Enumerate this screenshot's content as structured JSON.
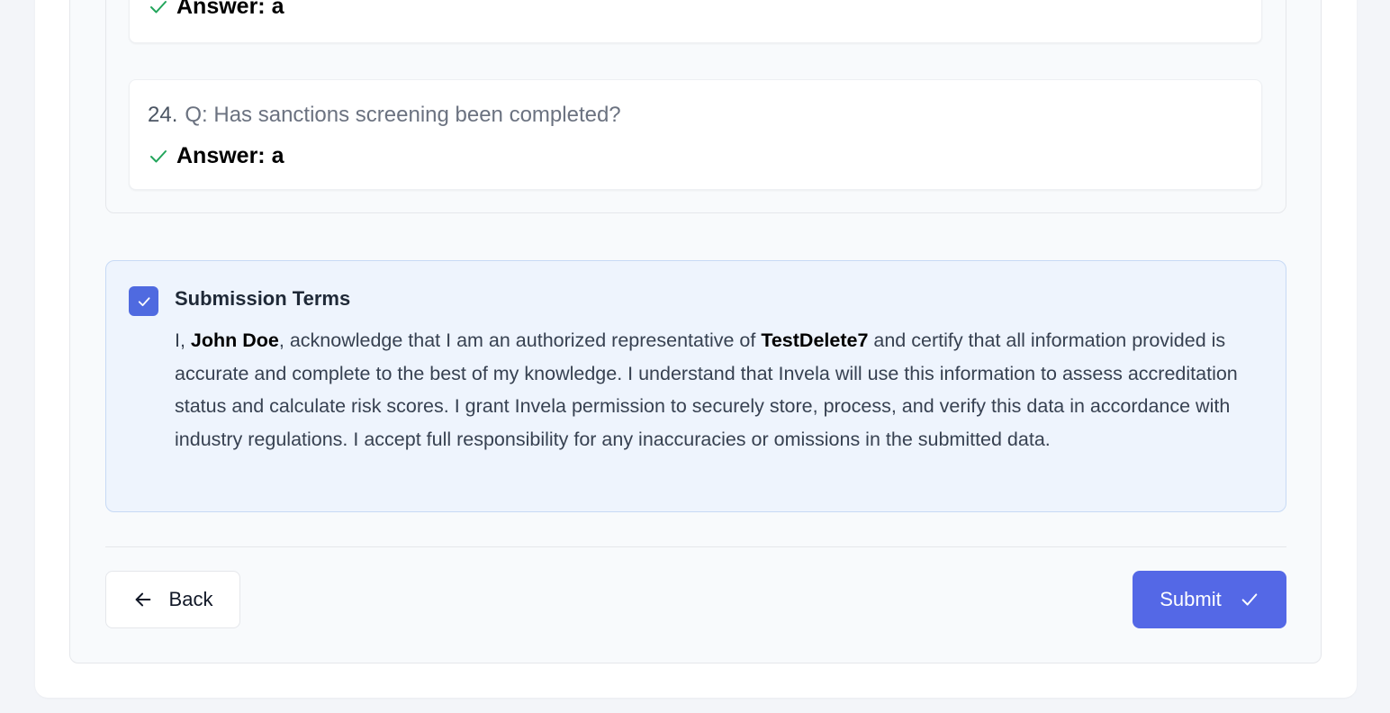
{
  "questions": [
    {
      "answer": "Answer: a"
    },
    {
      "number": "24.",
      "text": "Q: Has sanctions screening been completed?",
      "answer": "Answer: a"
    }
  ],
  "terms": {
    "checked": true,
    "title": "Submission Terms",
    "p1": "I, ",
    "name": "John Doe",
    "p2": ", acknowledge that I am an authorized representative of ",
    "company": "TestDelete7",
    "p3": " and certify that all information provided is accurate and complete to the best of my knowledge. I understand that Invela will use this information to assess accreditation status and calculate risk scores. I grant Invela permission to securely store, process, and verify this data in accordance with industry regulations. I accept full responsibility for any inaccuracies or omissions in the submitted data."
  },
  "actions": {
    "back_label": "Back",
    "submit_label": "Submit"
  },
  "colors": {
    "accent": "#5468e6",
    "success": "#22a55b",
    "terms_bg": "#eef4fd"
  },
  "icons": [
    "check-icon",
    "arrow-left-icon"
  ]
}
